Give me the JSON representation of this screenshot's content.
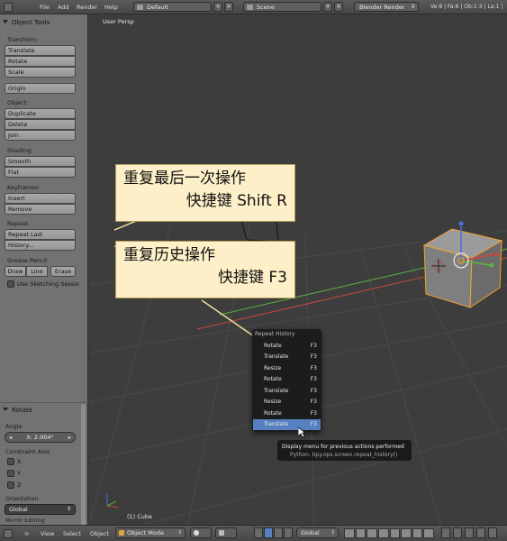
{
  "top_header": {
    "menus": [
      "File",
      "Add",
      "Render",
      "Help"
    ],
    "screen_layout": "Default",
    "scene": "Scene",
    "render_engine": "Blender Render",
    "stats": "Ve:8 | Fa:6 | Ob:1-3 | La:1 |"
  },
  "tool_shelf": {
    "title": "Object Tools",
    "transform": {
      "label": "Transform:",
      "buttons": [
        "Translate",
        "Rotate",
        "Scale"
      ]
    },
    "origin_button": "Origin",
    "object": {
      "label": "Object:",
      "buttons": [
        "Duplicate",
        "Delete",
        "Join"
      ]
    },
    "shading": {
      "label": "Shading:",
      "buttons": [
        "Smooth",
        "Flat"
      ]
    },
    "keyframes": {
      "label": "Keyframes:",
      "buttons": [
        "Insert",
        "Remove"
      ]
    },
    "repeat": {
      "label": "Repeat:",
      "buttons": [
        "Repeat Last",
        "History..."
      ]
    },
    "grease_pencil": {
      "label": "Grease Pencil:",
      "buttons": [
        "Draw",
        "Line",
        "Erase"
      ],
      "checkbox_label": "Use Sketching Sessio"
    }
  },
  "operator_panel": {
    "title": "Rotate",
    "angle_label": "Angle",
    "angle_value": "X: 2.004°",
    "constraint_label": "Constraint Axis",
    "axes": [
      "X",
      "Y",
      "Z"
    ],
    "orientation_label": "Orientation",
    "orientation_value": "Global",
    "cut_label": "Mirror Editing"
  },
  "viewport": {
    "view_name": "User Persp",
    "object_info": "(1) Cube"
  },
  "callouts": [
    {
      "line1": "重复最后一次操作",
      "line2": "快捷键 Shift R"
    },
    {
      "line1": "重复历史操作",
      "line2": "快捷键 F3"
    }
  ],
  "repeat_history": {
    "title": "Repeat History",
    "items": [
      {
        "label": "Rotate",
        "key": "F3"
      },
      {
        "label": "Translate",
        "key": "F3"
      },
      {
        "label": "Resize",
        "key": "F3"
      },
      {
        "label": "Rotate",
        "key": "F3"
      },
      {
        "label": "Translate",
        "key": "F3"
      },
      {
        "label": "Resize",
        "key": "F3"
      },
      {
        "label": "Rotate",
        "key": "F3"
      },
      {
        "label": "Translate",
        "key": "F3"
      }
    ],
    "selected_index": 7
  },
  "tooltip": {
    "line1": "Display menu for previous actions performed",
    "line2": "Python: bpy.ops.screen.repeat_history()"
  },
  "bottom_header": {
    "menus": [
      "View",
      "Select",
      "Object"
    ],
    "mode": "Object Mode",
    "orientation": "Global"
  },
  "colors": {
    "callout_bg": "#fdefc8",
    "selection_blue": "#5680c2",
    "object_select_orange": "#f7a030",
    "x_axis_red": "#c8483f",
    "y_axis_green": "#5db341"
  }
}
